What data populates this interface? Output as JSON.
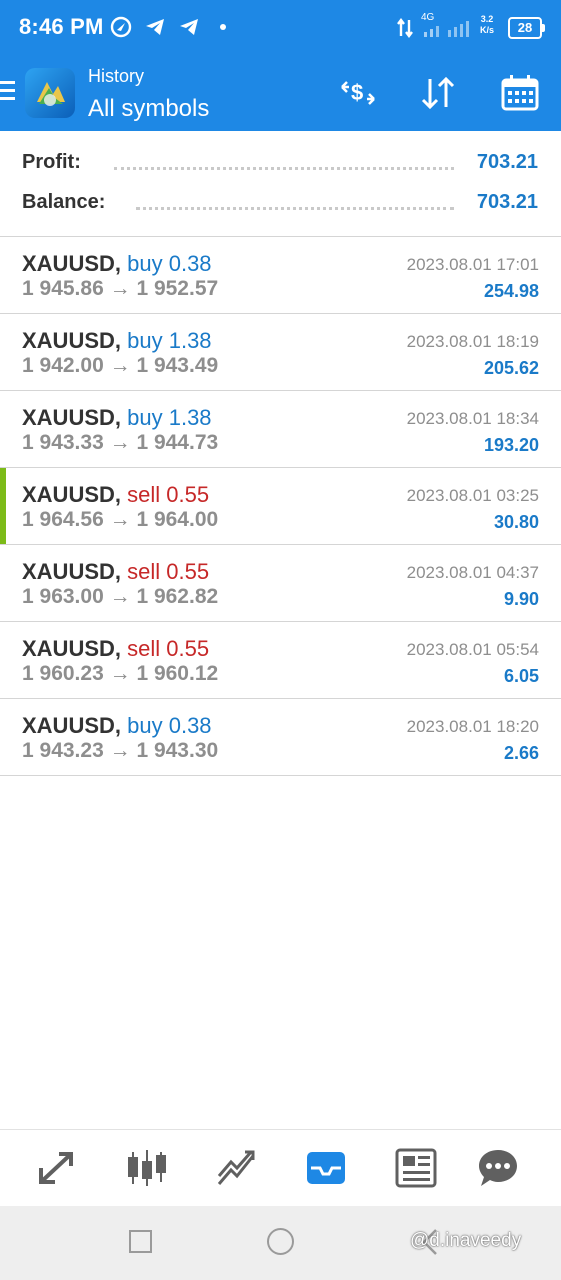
{
  "status_bar": {
    "time": "8:46 PM",
    "network": "4G",
    "speed_value": "3.2",
    "speed_unit": "K/s",
    "battery": "28"
  },
  "app_bar": {
    "subtitle": "History",
    "title": "All symbols",
    "icons": [
      "menu-icon",
      "metatrader-logo",
      "currency-sort-icon",
      "sort-arrows-icon",
      "calendar-icon"
    ]
  },
  "summary": {
    "profit_label": "Profit:",
    "profit_value": "703.21",
    "balance_label": "Balance:",
    "balance_value": "703.21"
  },
  "trades": [
    {
      "symbol": "XAUUSD,",
      "side": "buy",
      "volume": "buy 0.38",
      "open": "1 945.86",
      "close": "1 952.57",
      "arrow": "→",
      "datetime": "2023.08.01 17:01",
      "profit": "254.98",
      "selected": false
    },
    {
      "symbol": "XAUUSD,",
      "side": "buy",
      "volume": "buy 1.38",
      "open": "1 942.00",
      "close": "1 943.49",
      "arrow": "→",
      "datetime": "2023.08.01 18:19",
      "profit": "205.62",
      "selected": false
    },
    {
      "symbol": "XAUUSD,",
      "side": "buy",
      "volume": "buy 1.38",
      "open": "1 943.33",
      "close": "1 944.73",
      "arrow": "→",
      "datetime": "2023.08.01 18:34",
      "profit": "193.20",
      "selected": false
    },
    {
      "symbol": "XAUUSD,",
      "side": "sell",
      "volume": "sell 0.55",
      "open": "1 964.56",
      "close": "1 964.00",
      "arrow": "→",
      "datetime": "2023.08.01 03:25",
      "profit": "30.80",
      "selected": true
    },
    {
      "symbol": "XAUUSD,",
      "side": "sell",
      "volume": "sell 0.55",
      "open": "1 963.00",
      "close": "1 962.82",
      "arrow": "→",
      "datetime": "2023.08.01 04:37",
      "profit": "9.90",
      "selected": false
    },
    {
      "symbol": "XAUUSD,",
      "side": "sell",
      "volume": "sell 0.55",
      "open": "1 960.23",
      "close": "1 960.12",
      "arrow": "→",
      "datetime": "2023.08.01 05:54",
      "profit": "6.05",
      "selected": false
    },
    {
      "symbol": "XAUUSD,",
      "side": "buy",
      "volume": "buy 0.38",
      "open": "1 943.23",
      "close": "1 943.30",
      "arrow": "→",
      "datetime": "2023.08.01 18:20",
      "profit": "2.66",
      "selected": false
    }
  ],
  "bottom_nav": {
    "items": [
      "quotes-icon",
      "chart-candles-icon",
      "trade-icon",
      "history-inbox-icon",
      "news-icon",
      "chat-icon"
    ],
    "active": "history-inbox-icon"
  },
  "watermark": "@d.inaveedy",
  "colors": {
    "header": "#1e88e5",
    "buy": "#1a7ac8",
    "sell": "#c62828",
    "profit": "#1a7ac8",
    "selected_accent": "#7cbb18",
    "muted": "#8e8e8e"
  }
}
